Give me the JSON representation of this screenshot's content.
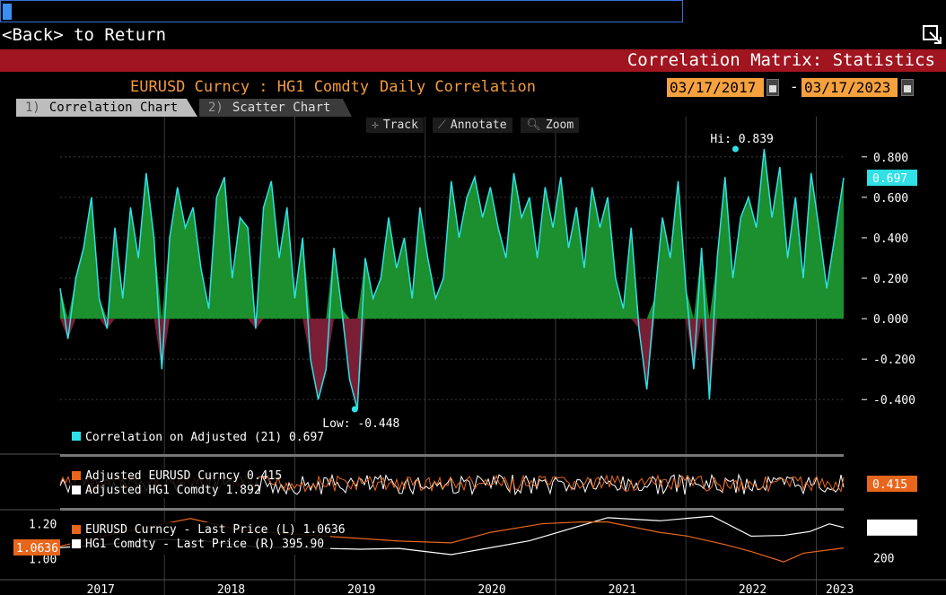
{
  "window": {
    "command_value": "",
    "back_label": "<Back> to Return",
    "title": "Correlation Matrix: Statistics"
  },
  "header": {
    "security_pair": "EURUSD Curncy  :  HG1 Comdty",
    "mode": "Daily Correlation",
    "start_date": "03/17/2017",
    "separator": "-",
    "end_date": "03/17/2023"
  },
  "tabs": [
    {
      "num": "1)",
      "label": "Correlation Chart"
    },
    {
      "num": "2)",
      "label": "Scatter Chart"
    }
  ],
  "tools": [
    {
      "icon": "crosshair-icon",
      "glyph": "✛",
      "label": "Track"
    },
    {
      "icon": "pencil-icon",
      "glyph": "⟋",
      "label": "Annotate"
    },
    {
      "icon": "magnifier-icon",
      "glyph": "🔍︎",
      "label": "Zoom"
    }
  ],
  "colors": {
    "positive_fill": "#1c8f2e",
    "negative_fill": "#7a1e35",
    "correlation_line": "#2fe0e6",
    "eur_line": "#e8661c",
    "hg_line": "#ffffff",
    "grid": "#3a3a3a"
  },
  "chart_data": [
    {
      "type": "area",
      "name_label": "Correlation on Adjusted (21)",
      "legend_value": "0.697",
      "current_value": "0.697",
      "hi_label": "Hi: 0.839",
      "low_label": "Low: -0.448",
      "yticks": [
        "0.800",
        "0.600",
        "0.400",
        "0.200",
        "0.000",
        "-0.200",
        "-0.400"
      ],
      "ylim": [
        -0.55,
        0.95
      ],
      "xlim": [
        2017.2,
        2023.21
      ],
      "hi": {
        "x": 2022.38,
        "y": 0.839
      },
      "low": {
        "x": 2019.46,
        "y": -0.448
      },
      "x": [
        2017.2,
        2017.26,
        2017.32,
        2017.38,
        2017.44,
        2017.5,
        2017.56,
        2017.62,
        2017.68,
        2017.74,
        2017.8,
        2017.86,
        2017.92,
        2017.98,
        2018.04,
        2018.1,
        2018.16,
        2018.22,
        2018.28,
        2018.34,
        2018.4,
        2018.46,
        2018.52,
        2018.58,
        2018.64,
        2018.7,
        2018.76,
        2018.82,
        2018.88,
        2018.94,
        2019.0,
        2019.06,
        2019.12,
        2019.18,
        2019.24,
        2019.3,
        2019.36,
        2019.42,
        2019.48,
        2019.54,
        2019.6,
        2019.66,
        2019.72,
        2019.78,
        2019.84,
        2019.9,
        2019.96,
        2020.02,
        2020.08,
        2020.14,
        2020.2,
        2020.26,
        2020.32,
        2020.38,
        2020.44,
        2020.5,
        2020.56,
        2020.62,
        2020.68,
        2020.74,
        2020.8,
        2020.86,
        2020.92,
        2020.98,
        2021.04,
        2021.1,
        2021.16,
        2021.22,
        2021.28,
        2021.34,
        2021.4,
        2021.46,
        2021.52,
        2021.58,
        2021.64,
        2021.7,
        2021.76,
        2021.82,
        2021.88,
        2021.94,
        2022.0,
        2022.06,
        2022.12,
        2022.18,
        2022.24,
        2022.3,
        2022.36,
        2022.42,
        2022.48,
        2022.54,
        2022.6,
        2022.66,
        2022.72,
        2022.78,
        2022.84,
        2022.9,
        2022.96,
        2023.02,
        2023.08,
        2023.14,
        2023.21
      ],
      "y": [
        0.15,
        -0.1,
        0.2,
        0.35,
        0.6,
        0.1,
        -0.05,
        0.45,
        0.1,
        0.55,
        0.3,
        0.72,
        0.4,
        -0.25,
        0.4,
        0.65,
        0.45,
        0.55,
        0.25,
        0.05,
        0.6,
        0.7,
        0.2,
        0.5,
        0.45,
        -0.05,
        0.55,
        0.68,
        0.3,
        0.55,
        0.1,
        0.4,
        -0.2,
        -0.4,
        -0.25,
        0.35,
        0.05,
        -0.3,
        -0.448,
        0.3,
        0.1,
        0.2,
        0.5,
        0.25,
        0.4,
        0.1,
        0.55,
        0.3,
        0.1,
        0.2,
        0.68,
        0.4,
        0.6,
        0.7,
        0.5,
        0.65,
        0.45,
        0.3,
        0.72,
        0.5,
        0.6,
        0.3,
        0.65,
        0.45,
        0.7,
        0.35,
        0.55,
        0.25,
        0.65,
        0.45,
        0.6,
        0.2,
        0.05,
        0.45,
        -0.05,
        -0.35,
        0.1,
        0.5,
        0.3,
        0.68,
        0.15,
        -0.25,
        0.35,
        -0.4,
        0.3,
        0.7,
        0.2,
        0.5,
        0.6,
        0.45,
        0.839,
        0.5,
        0.75,
        0.3,
        0.6,
        0.2,
        0.72,
        0.45,
        0.15,
        0.4,
        0.697
      ]
    },
    {
      "type": "line",
      "series": [
        {
          "name": "Adjusted EURUSD Curncy",
          "value": "0.415"
        },
        {
          "name": "Adjusted HG1 Comdty",
          "value": "1.892"
        }
      ],
      "current_value": "0.415"
    },
    {
      "type": "line",
      "series": [
        {
          "name": "EURUSD Curncy - Last Price (L)",
          "value": "1.0636",
          "x": [
            2017.2,
            2017.6,
            2018.0,
            2018.2,
            2018.6,
            2019.0,
            2019.4,
            2019.8,
            2020.2,
            2020.5,
            2020.9,
            2021.2,
            2021.4,
            2021.8,
            2022.0,
            2022.3,
            2022.5,
            2022.75,
            2022.9,
            2023.21
          ],
          "y": [
            1.07,
            1.14,
            1.2,
            1.23,
            1.16,
            1.14,
            1.12,
            1.1,
            1.09,
            1.15,
            1.2,
            1.21,
            1.21,
            1.15,
            1.13,
            1.08,
            1.04,
            0.98,
            1.03,
            1.06
          ]
        },
        {
          "name": "HG1 Comdty - Last Price (R)",
          "value": "395.90",
          "x": [
            2017.2,
            2017.6,
            2018.0,
            2018.3,
            2018.7,
            2019.0,
            2019.5,
            2019.8,
            2020.2,
            2020.4,
            2020.8,
            2021.2,
            2021.4,
            2021.8,
            2022.2,
            2022.5,
            2022.75,
            2022.95,
            2023.1,
            2023.21
          ],
          "y": [
            265,
            290,
            320,
            310,
            270,
            265,
            255,
            260,
            220,
            250,
            310,
            410,
            460,
            440,
            470,
            340,
            345,
            370,
            420,
            396
          ]
        }
      ],
      "left_ticks": [
        "1.20",
        "1.00"
      ],
      "left_current": "1.0636",
      "right_ticks": [
        "200"
      ],
      "right_current": "395.90",
      "left_ylim": [
        0.96,
        1.27
      ],
      "right_ylim": [
        150,
        500
      ]
    }
  ],
  "x_axis": [
    "2017",
    "2018",
    "2019",
    "2020",
    "2021",
    "2022",
    "2023"
  ]
}
